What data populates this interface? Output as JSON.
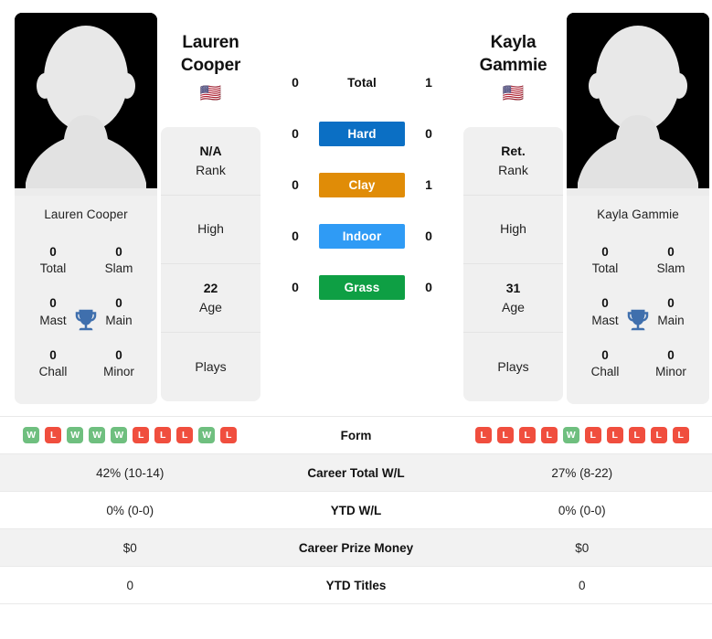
{
  "players": {
    "left": {
      "first_name": "Lauren",
      "last_name": "Cooper",
      "full_name": "Lauren Cooper",
      "flag": "🇺🇸",
      "flag_name": "united-states-flag",
      "titles": {
        "total": "0",
        "total_label": "Total",
        "slam": "0",
        "slam_label": "Slam",
        "mast": "0",
        "mast_label": "Mast",
        "main": "0",
        "main_label": "Main",
        "chall": "0",
        "chall_label": "Chall",
        "minor": "0",
        "minor_label": "Minor"
      },
      "info": {
        "rank_value": "N/A",
        "rank_label": "Rank",
        "high_value": "",
        "high_label": "High",
        "age_value": "22",
        "age_label": "Age",
        "plays_value": "",
        "plays_label": "Plays"
      },
      "form": [
        "W",
        "L",
        "W",
        "W",
        "W",
        "L",
        "L",
        "L",
        "W",
        "L"
      ],
      "career_total_wl": "42% (10-14)",
      "ytd_wl": "0% (0-0)",
      "career_prize_money": "$0",
      "ytd_titles": "0"
    },
    "right": {
      "first_name": "Kayla",
      "last_name": "Gammie",
      "full_name": "Kayla Gammie",
      "flag": "🇺🇸",
      "flag_name": "united-states-flag",
      "titles": {
        "total": "0",
        "total_label": "Total",
        "slam": "0",
        "slam_label": "Slam",
        "mast": "0",
        "mast_label": "Mast",
        "main": "0",
        "main_label": "Main",
        "chall": "0",
        "chall_label": "Chall",
        "minor": "0",
        "minor_label": "Minor"
      },
      "info": {
        "rank_value": "Ret.",
        "rank_label": "Rank",
        "high_value": "",
        "high_label": "High",
        "age_value": "31",
        "age_label": "Age",
        "plays_value": "",
        "plays_label": "Plays"
      },
      "form": [
        "L",
        "L",
        "L",
        "L",
        "W",
        "L",
        "L",
        "L",
        "L",
        "L"
      ],
      "career_total_wl": "27% (8-22)",
      "ytd_wl": "0% (0-0)",
      "career_prize_money": "$0",
      "ytd_titles": "0"
    }
  },
  "head_to_head": {
    "rows": [
      {
        "label": "Total",
        "left": "0",
        "right": "1",
        "color": "",
        "style": "plain"
      },
      {
        "label": "Hard",
        "left": "0",
        "right": "0",
        "color": "#0b6fc4",
        "style": "badge"
      },
      {
        "label": "Clay",
        "left": "0",
        "right": "1",
        "color": "#e08c07",
        "style": "badge"
      },
      {
        "label": "Indoor",
        "left": "0",
        "right": "0",
        "color": "#2f9bf5",
        "style": "badge"
      },
      {
        "label": "Grass",
        "left": "0",
        "right": "0",
        "color": "#0e9f44",
        "style": "badge"
      }
    ]
  },
  "stats_table": {
    "rows": [
      {
        "label": "Form",
        "type": "form"
      },
      {
        "label": "Career Total W/L",
        "type": "text",
        "key": "career_total_wl"
      },
      {
        "label": "YTD W/L",
        "type": "text",
        "key": "ytd_wl"
      },
      {
        "label": "Career Prize Money",
        "type": "text",
        "key": "career_prize_money"
      },
      {
        "label": "YTD Titles",
        "type": "text",
        "key": "ytd_titles"
      }
    ]
  },
  "colors": {
    "win": "#6fbf7f",
    "loss": "#f04e3e",
    "card_bg": "#f0f0f0",
    "row_shade": "#f2f2f2",
    "trophy": "#3f6fad"
  }
}
